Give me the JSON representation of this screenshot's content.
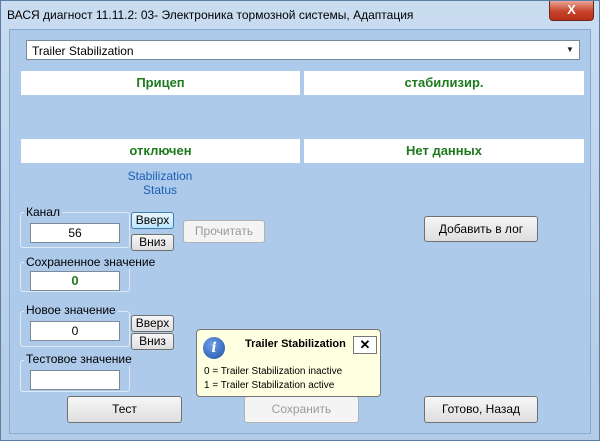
{
  "window": {
    "title": "ВАСЯ диагност 11.11.2: 03- Электроника тормозной системы, Адаптация",
    "close_glyph": "X"
  },
  "combo": {
    "value": "Trailer Stabilization"
  },
  "cells": {
    "r1c1": "Прицеп",
    "r1c2": "стабилизир.",
    "r2c1": "отключен",
    "r2c2": "Нет данных"
  },
  "status_label": {
    "line1": "Stabilization",
    "line2": "Status"
  },
  "channel": {
    "label": "Канал",
    "value": "56",
    "up": "Вверх",
    "down": "Вниз"
  },
  "saved": {
    "label": "Сохраненное значение",
    "value": "0"
  },
  "new_value": {
    "label": "Новое значение",
    "value": "0",
    "up": "Вверх",
    "down": "Вниз"
  },
  "test_value": {
    "label": "Тестовое значение",
    "value": ""
  },
  "buttons": {
    "read": "Прочитать",
    "add_log": "Добавить в лог",
    "test": "Тест",
    "save": "Сохранить",
    "done": "Готово, Назад"
  },
  "tooltip": {
    "icon": "i",
    "icon_name": "info-icon",
    "title": "Trailer Stabilization",
    "close": "✕",
    "line1": "0 = Trailer Stabilization inactive",
    "line2": "1 = Trailer Stabilization active"
  }
}
